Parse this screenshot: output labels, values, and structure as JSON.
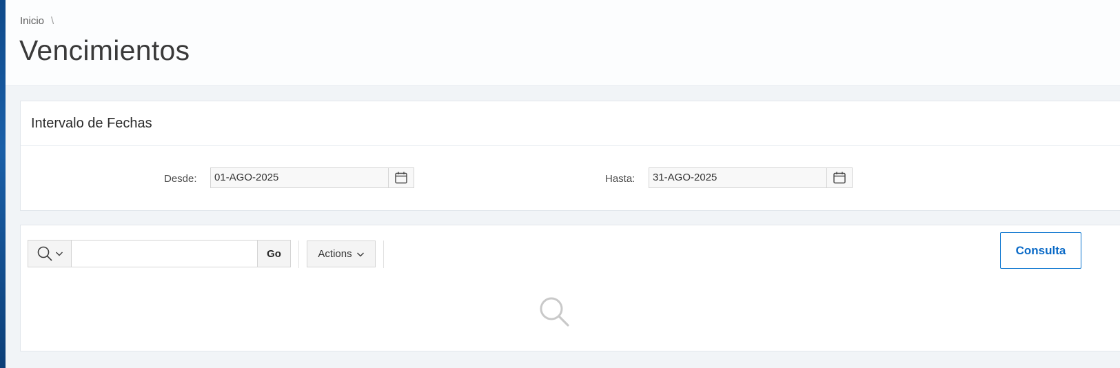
{
  "breadcrumb": {
    "home": "Inicio",
    "separator": "\\"
  },
  "page": {
    "title": "Vencimientos"
  },
  "date_region": {
    "title": "Intervalo de Fechas",
    "from_label": "Desde:",
    "from_value": "01-AGO-2025",
    "to_label": "Hasta:",
    "to_value": "31-AGO-2025",
    "calendar_icon": "calendar-icon"
  },
  "report": {
    "search_placeholder": "",
    "search_value": "",
    "go_label": "Go",
    "actions_label": "Actions",
    "consulta_label": "Consulta",
    "empty_icon": "search-icon"
  },
  "colors": {
    "accent": "#0572ce",
    "page_bg": "#f1f4f7",
    "sidebar_edge": "#1a5fa8"
  }
}
